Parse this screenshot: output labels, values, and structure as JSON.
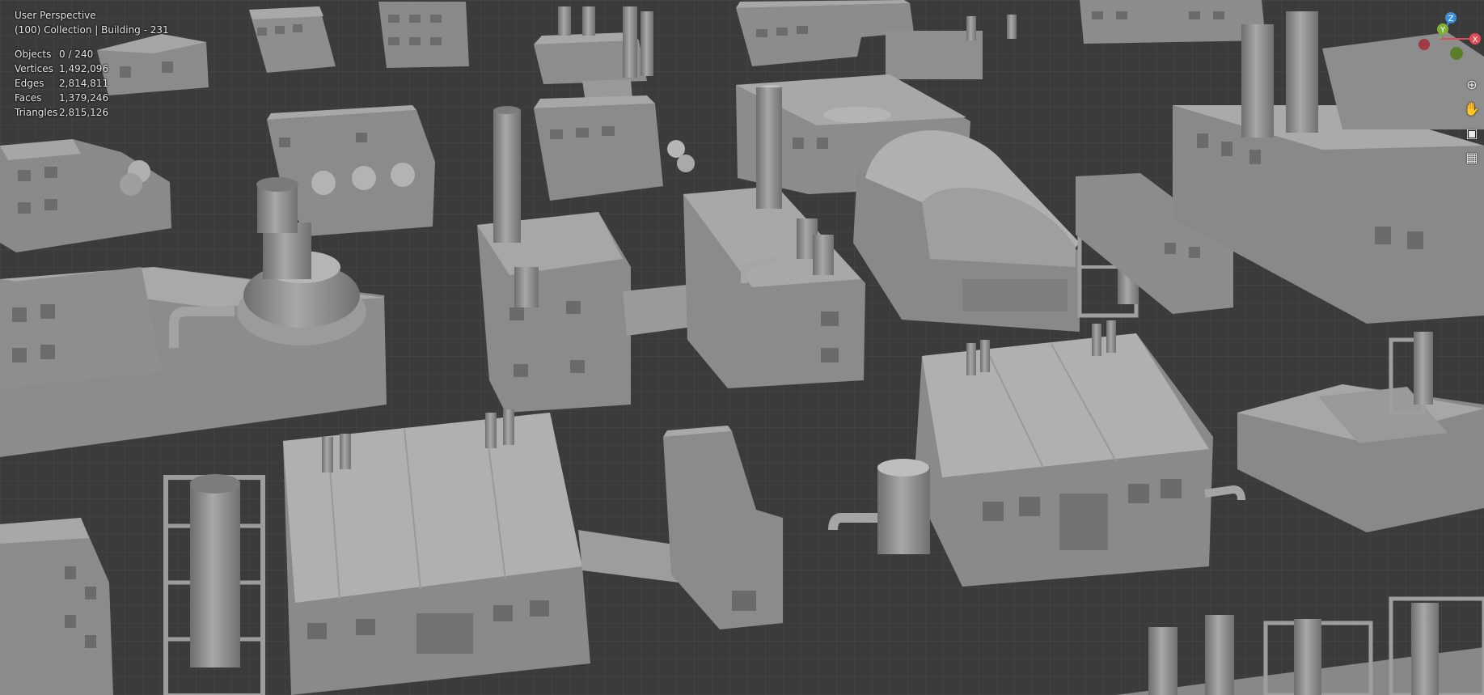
{
  "viewport": {
    "view_name": "User Perspective",
    "collection_info": "(100) Collection | Building - 231"
  },
  "stats": [
    {
      "label": "Objects",
      "value": "0 / 240"
    },
    {
      "label": "Vertices",
      "value": "1,492,096"
    },
    {
      "label": "Edges",
      "value": "2,814,811"
    },
    {
      "label": "Faces",
      "value": "1,379,246"
    },
    {
      "label": "Triangles",
      "value": "2,815,126"
    }
  ],
  "gizmo": {
    "axes": [
      "Z",
      "Y",
      "X"
    ],
    "colors": {
      "x": "#e24a55",
      "y": "#7fb034",
      "z": "#3f8fe0",
      "neg_x": "#a23a44",
      "neg_y": "#5a7f2a"
    }
  },
  "nav_tools": [
    {
      "icon": "zoom-icon",
      "glyph": "⊕"
    },
    {
      "icon": "hand-pan-icon",
      "glyph": "✋"
    },
    {
      "icon": "camera-icon",
      "glyph": "▣"
    },
    {
      "icon": "grid-ortho-icon",
      "glyph": "▦"
    }
  ]
}
